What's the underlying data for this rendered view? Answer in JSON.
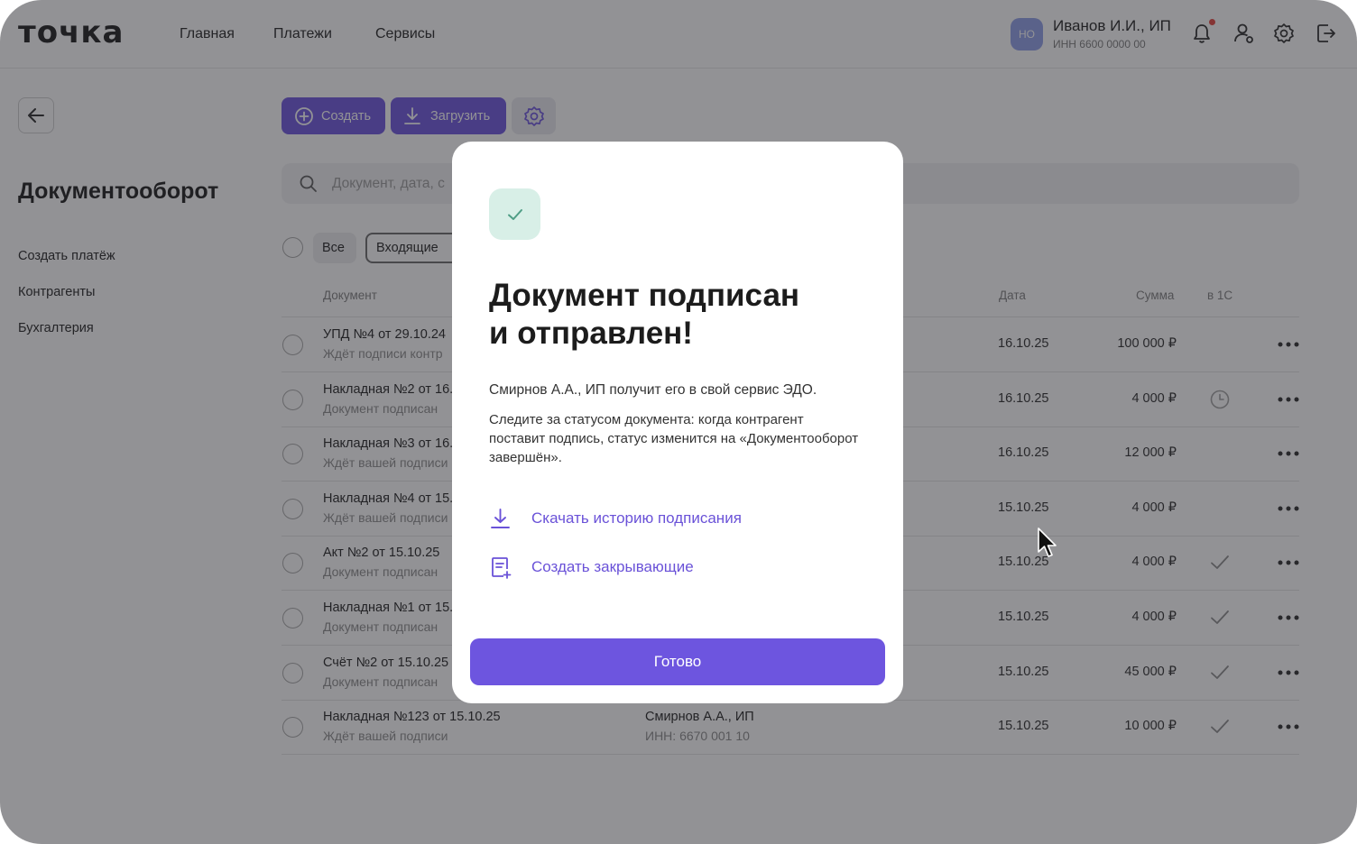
{
  "header": {
    "logo": "точка",
    "nav": [
      "Главная",
      "Платежи",
      "Сервисы"
    ],
    "avatar_initials": "НО",
    "user_name": "Иванов И.И., ИП",
    "user_inn": "ИНН 6600 0000 00"
  },
  "sidebar": {
    "title": "Документооборот",
    "links": [
      "Создать платёж",
      "Контрагенты",
      "Бухгалтерия"
    ]
  },
  "toolbar": {
    "create_label": "Создать",
    "upload_label": "Загрузить",
    "search_placeholder": "Документ, дата, с"
  },
  "filters": {
    "all": "Все",
    "incoming": "Входящие"
  },
  "table": {
    "headers": {
      "document": "Документ",
      "date": "Дата",
      "sum": "Сумма",
      "in1c": "в 1С"
    },
    "rows": [
      {
        "title": "УПД №4 от 29.10.24",
        "status": "Ждёт подписи контр",
        "date": "16.10.25",
        "sum": "100 000 ₽",
        "sync": "none"
      },
      {
        "title": "Накладная №2 от 16.",
        "status": "Документ подписан",
        "date": "16.10.25",
        "sum": "4 000 ₽",
        "sync": "pending"
      },
      {
        "title": "Накладная №3 от 16.",
        "status": "Ждёт вашей подписи",
        "date": "16.10.25",
        "sum": "12 000 ₽",
        "sync": "none"
      },
      {
        "title": "Накладная №4 от 15.",
        "status": "Ждёт вашей подписи",
        "date": "15.10.25",
        "sum": "4 000 ₽",
        "sync": "none"
      },
      {
        "title": "Акт №2 от 15.10.25",
        "status": "Документ подписан",
        "date": "15.10.25",
        "sum": "4 000 ₽",
        "sync": "done"
      },
      {
        "title": "Накладная №1 от 15.1",
        "status": "Документ подписан",
        "date": "15.10.25",
        "sum": "4 000 ₽",
        "sync": "done"
      },
      {
        "title": "Счёт №2 от 15.10.25",
        "status": "Документ подписан",
        "date": "15.10.25",
        "sum": "45 000 ₽",
        "sync": "done"
      },
      {
        "title": "Накладная №123 от 15.10.25",
        "status": "Ждёт вашей подписи",
        "counterparty": "Смирнов А.А., ИП",
        "counterparty_inn": "ИНН: 6670 001 10",
        "date": "15.10.25",
        "sum": "10 000 ₽",
        "sync": "done"
      }
    ]
  },
  "modal": {
    "title": "Документ подписан и отправлен!",
    "title_line1": "Документ подписан",
    "title_line2": "и отправлен!",
    "text1": "Смирнов А.А., ИП получит его в свой сервис ЭДО.",
    "text2": "Следите за статусом документа: когда контрагент поставит подпись, статус изменится на «Документооборот завершён».",
    "link_download": "Скачать историю подписания",
    "link_closing": "Создать закрывающие",
    "done_label": "Готово"
  },
  "colors": {
    "accent": "#6d55df",
    "link": "#6a52d8",
    "success_bg": "#d8efe7",
    "success_check": "#4f9e86",
    "overlay": "rgba(38,38,44,0.5)",
    "notification_dot": "#e4433d"
  }
}
